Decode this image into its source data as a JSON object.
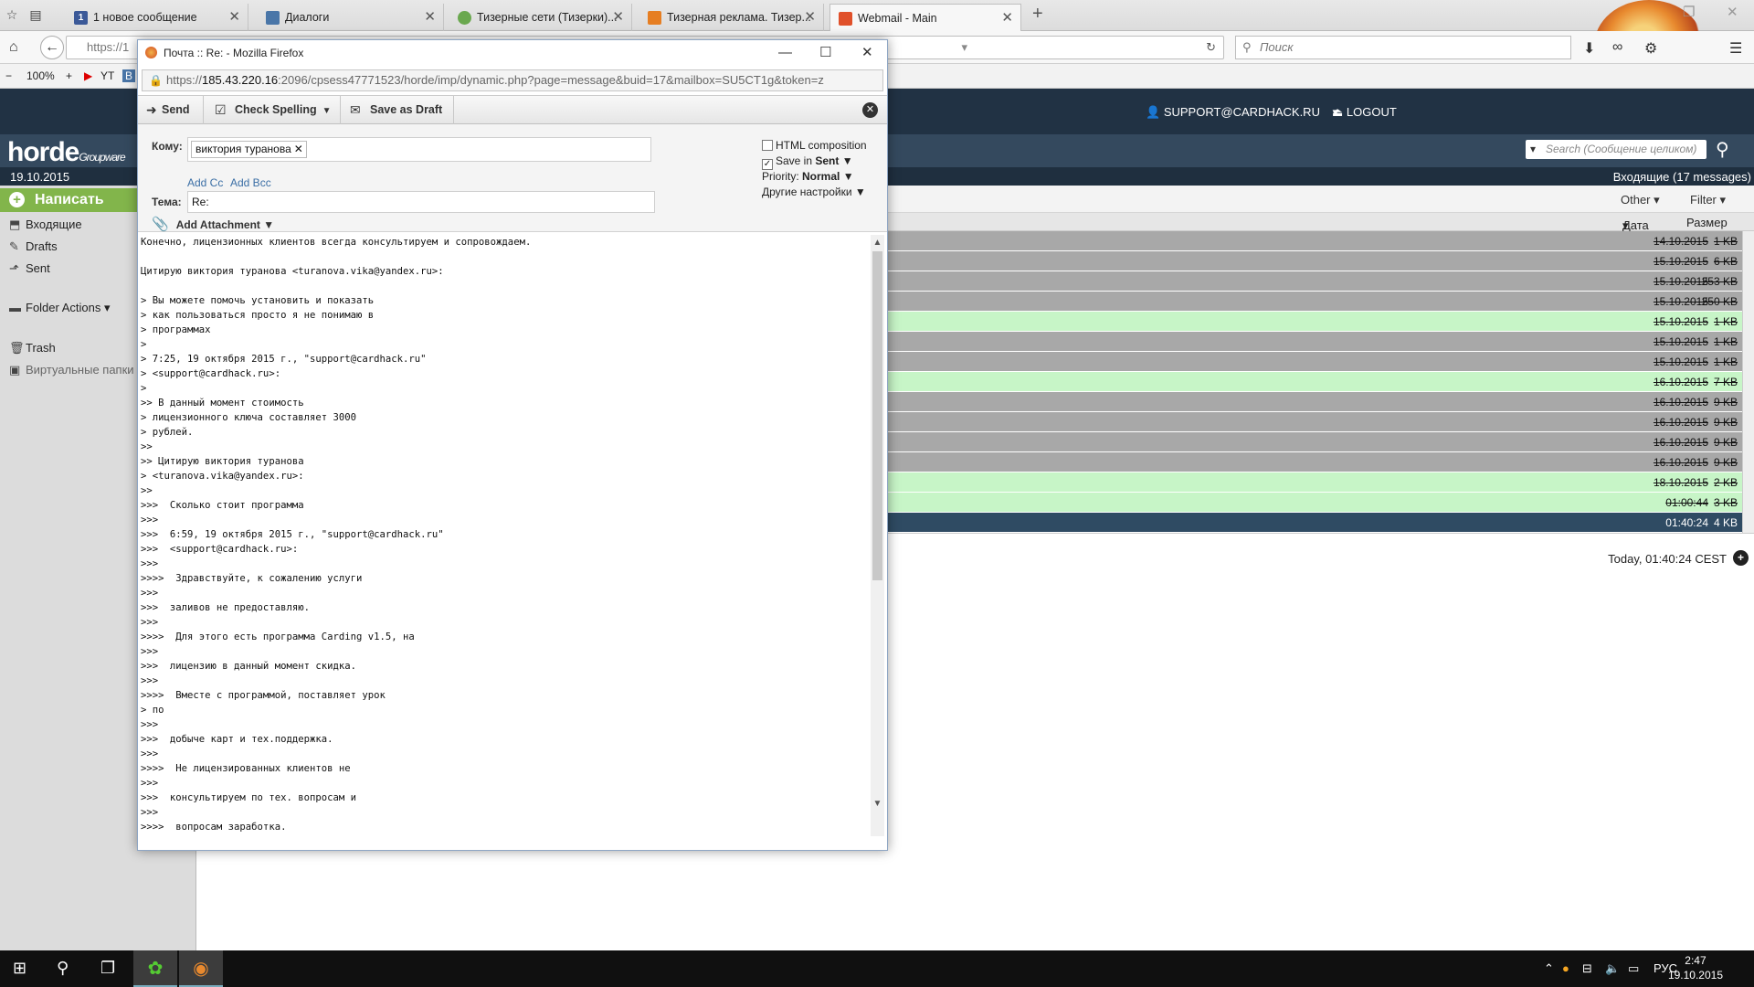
{
  "browser": {
    "tabs": [
      {
        "label": "1 новое сообщение",
        "fav_text": "1",
        "fav_color": "#3b5998",
        "active": false
      },
      {
        "label": "Диалоги",
        "fav_text": "",
        "fav_color": "#4a76a8",
        "active": false
      },
      {
        "label": "Тизерные сети (Тизерки)...",
        "fav_text": "",
        "fav_color": "#6aa84f",
        "active": false
      },
      {
        "label": "Тизерная реклама. Тизер...",
        "fav_text": "",
        "fav_color": "#e67e22",
        "active": false
      },
      {
        "label": "Webmail - Main",
        "fav_text": "",
        "fav_color": "#e0502a",
        "active": true
      }
    ],
    "url_prefix": "https://1",
    "search_placeholder": "Поиск",
    "zoom": "100%",
    "bookmarks": [
      "YT",
      "B"
    ]
  },
  "horde": {
    "user": "SUPPORT@CARDHACK.RU",
    "logout": "LOGOUT",
    "logo": "horde",
    "logo_sub": "Groupware",
    "search_placeholder": "Search (Сообщение целиком)",
    "date": "19.10.2015",
    "inbox_count": "Входящие (17 messages)",
    "compose": "Написать",
    "folders": {
      "inbox": "Входящие",
      "drafts": "Drafts",
      "sent": "Sent",
      "folder_actions": "Folder Actions",
      "trash": "Trash",
      "virtual": "Виртуальные папки"
    },
    "filter": {
      "other": "Other",
      "filter": "Filter"
    },
    "columns": {
      "date": "Дата",
      "size": "Размер"
    },
    "rows": [
      {
        "date": "14.10.2015",
        "size": "1 KB",
        "style": "gray",
        "strike": true
      },
      {
        "date": "15.10.2015",
        "size": "6 KB",
        "style": "gray",
        "strike": true
      },
      {
        "date": "15.10.2015",
        "size": "253 KB",
        "style": "gray",
        "strike": true
      },
      {
        "date": "15.10.2015",
        "size": "250 KB",
        "style": "gray",
        "strike": true
      },
      {
        "date": "15.10.2015",
        "size": "1 KB",
        "style": "green",
        "strike": true
      },
      {
        "date": "15.10.2015",
        "size": "1 KB",
        "style": "gray",
        "strike": true
      },
      {
        "date": "15.10.2015",
        "size": "1 KB",
        "style": "gray",
        "strike": true
      },
      {
        "date": "16.10.2015",
        "size": "7 KB",
        "style": "green",
        "strike": true
      },
      {
        "date": "16.10.2015",
        "size": "9 KB",
        "style": "gray",
        "strike": true
      },
      {
        "date": "16.10.2015",
        "size": "9 KB",
        "style": "gray",
        "strike": true
      },
      {
        "date": "16.10.2015",
        "size": "9 KB",
        "style": "gray",
        "strike": true
      },
      {
        "date": "16.10.2015",
        "size": "9 KB",
        "style": "gray",
        "strike": true
      },
      {
        "date": "18.10.2015",
        "size": "2 KB",
        "style": "green",
        "strike": true
      },
      {
        "date": "01:00:44",
        "size": "3 KB",
        "style": "green",
        "strike": true
      },
      {
        "date": "01:40:24",
        "size": "4 KB",
        "style": "sel",
        "strike": false
      }
    ],
    "preview_time": "Today, 01:40:24 CEST"
  },
  "popup": {
    "title": "Почта :: Re: - Mozilla Firefox",
    "url_scheme": "https://",
    "url_host": "185.43.220.16",
    "url_rest": ":2096/cpsess47771523/horde/imp/dynamic.php?page=message&buid=17&mailbox=SU5CT1g&token=z",
    "toolbar": {
      "send": "Send",
      "spell": "Check Spelling",
      "draft": "Save as Draft"
    },
    "to_label": "Кому:",
    "to_chip": "виктория туранова",
    "add_cc": "Add Cc",
    "add_bcc": "Add Bcc",
    "subject_label": "Тема:",
    "subject_value": "Re:",
    "attachment": "Add Attachment",
    "options": {
      "html": "HTML composition",
      "save_in": "Save in",
      "sent": "Sent",
      "priority": "Priority:",
      "priority_value": "Normal",
      "other": "Другие настройки"
    },
    "body_lines": [
      "Конечно, лицензионных клиентов всегда консультируем и сопровождаем.",
      "",
      "Цитирую виктория туранова <turanova.vika@yandex.ru>:",
      "",
      "> Вы можете помочь установить и показать",
      "> как пользоваться просто я не понимаю в",
      "> программах",
      ">",
      "> 7:25, 19 октября 2015 г., \"support@cardhack.ru\"",
      "> <support@cardhack.ru>:",
      ">",
      ">> В данный момент стоимость",
      "> лицензионного ключа составляет 3000",
      "> рублей.",
      ">>",
      ">> Цитирую виктория туранова",
      "> <turanova.vika@yandex.ru>:",
      ">>",
      ">>>  Сколько стоит программа",
      ">>>",
      ">>>  6:59, 19 октября 2015 г., \"support@cardhack.ru\"",
      ">>>  <support@cardhack.ru>:",
      ">>>",
      ">>>>  Здравствуйте, к сожалению услуги",
      ">>>",
      ">>>  заливов не предоставляю.",
      ">>>",
      ">>>>  Для этого есть программа Carding v1.5, на",
      ">>>",
      ">>>  лицензию в данный момент скидка.",
      ">>>",
      ">>>>  Вместе с программой, поставляет урок",
      "> по",
      ">>>",
      ">>>  добыче карт и тех.поддержка.",
      ">>>",
      ">>>>  Не лицензированных клиентов не",
      ">>>",
      ">>>  консультируем по тех. вопросам и",
      ">>>",
      ">>>>  вопросам заработка."
    ]
  },
  "taskbar": {
    "lang": "РУС",
    "time": "2:47",
    "date": "19.10.2015"
  }
}
